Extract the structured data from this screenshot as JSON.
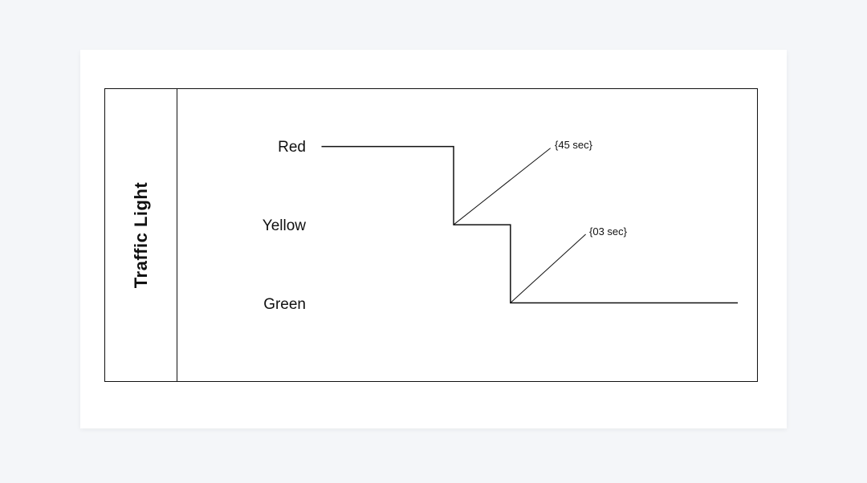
{
  "diagram": {
    "title": "Traffic Light",
    "states": [
      {
        "label": "Red"
      },
      {
        "label": "Yellow"
      },
      {
        "label": "Green"
      }
    ],
    "transitions": [
      {
        "duration": "{45 sec}"
      },
      {
        "duration": "{03 sec}"
      }
    ]
  },
  "chart_data": {
    "type": "timing-diagram",
    "title": "Traffic Light",
    "categories": [
      "Red",
      "Yellow",
      "Green"
    ],
    "transitions": [
      {
        "from": "Red",
        "to": "Yellow",
        "duration_label": "{45 sec}",
        "duration_sec": 45
      },
      {
        "from": "Yellow",
        "to": "Green",
        "duration_label": "{03 sec}",
        "duration_sec": 3
      }
    ]
  }
}
